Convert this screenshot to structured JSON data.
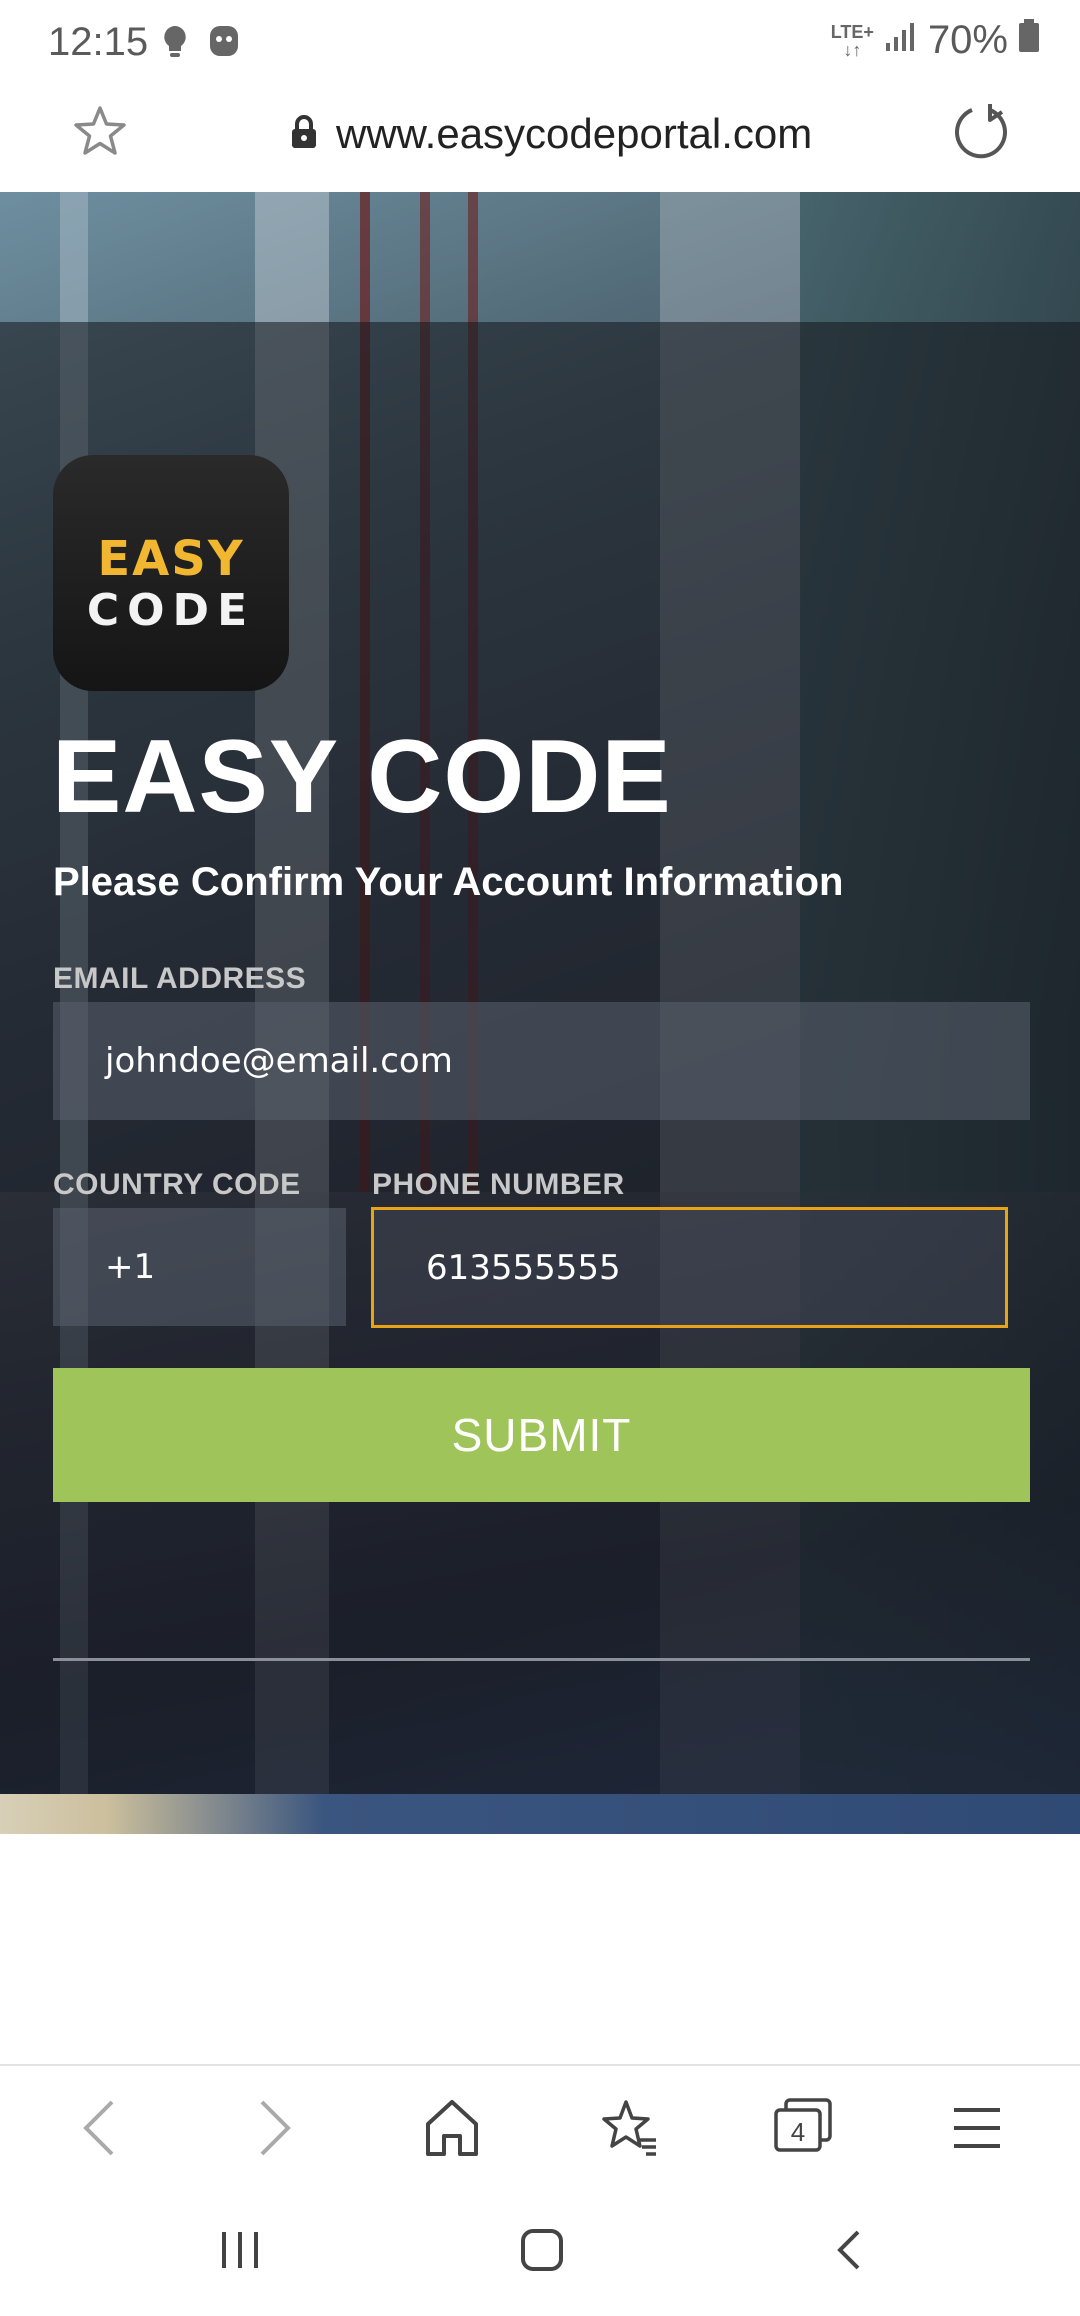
{
  "status_bar": {
    "time": "12:15",
    "network": "LTE+",
    "battery": "70%"
  },
  "url_bar": {
    "url": "www.easycodeportal.com"
  },
  "page": {
    "logo_line1": "EASY",
    "logo_line2": "CODE",
    "title": "EASY CODE",
    "subtitle": "Please Confirm Your Account Information",
    "email_label": "EMAIL ADDRESS",
    "email_value": "johndoe@email.com",
    "country_code_label": "COUNTRY CODE",
    "country_code_value": "+1",
    "phone_label": "PHONE NUMBER",
    "phone_value": "613555555",
    "submit_label": "SUBMIT"
  },
  "bottom_bar": {
    "tab_count": "4"
  },
  "colors": {
    "accent_submit": "#9fc55a",
    "focus_border": "#e8a317",
    "logo_easy": "#f2b731"
  }
}
